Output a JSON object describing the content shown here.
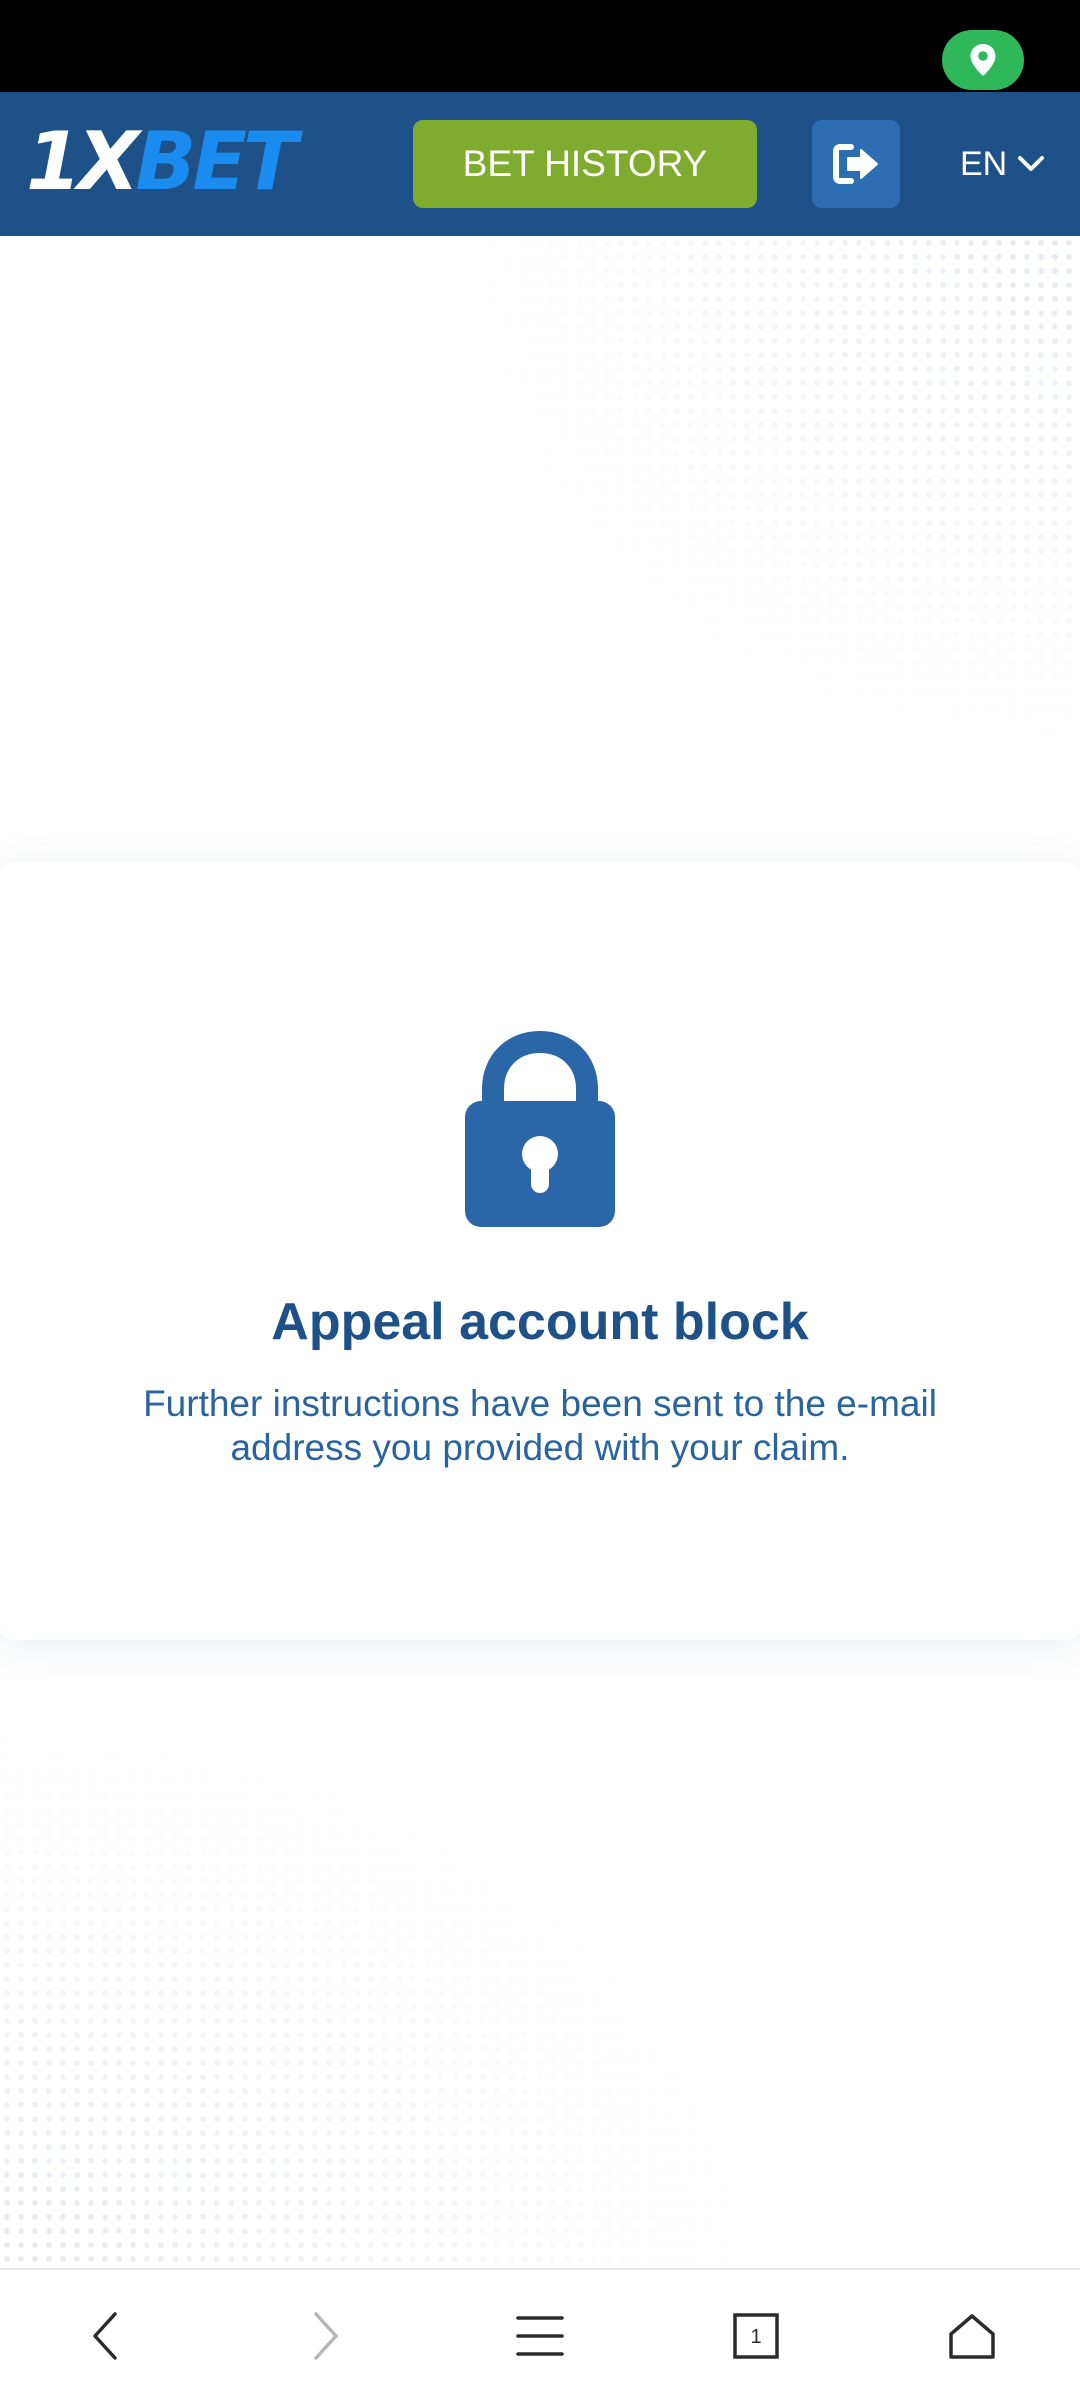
{
  "header": {
    "logo": {
      "part1": "1X",
      "part2": "BET"
    },
    "bet_history_label": "BET HISTORY",
    "language": "EN"
  },
  "card": {
    "title": "Appeal account block",
    "message": "Further instructions have been sent to the e-mail address you provided with your claim."
  },
  "browser_nav": {
    "tabs_count": "1"
  },
  "icons": {
    "status": "location-pin-icon",
    "logout": "logout-icon",
    "language": "chevron-down-icon",
    "card": "lock-icon",
    "nav": [
      "back-icon",
      "forward-icon",
      "menu-icon",
      "tabs-icon",
      "home-icon"
    ]
  },
  "colors": {
    "header_bg": "#1f5189",
    "bet_history_bg": "#7fac2e",
    "logout_bg": "#2d6eb3",
    "logo_accent": "#1a8cf0",
    "title": "#1f5189",
    "message": "#2a64a0",
    "lock": "#2a66a8",
    "location_pill": "#2fb85a"
  }
}
